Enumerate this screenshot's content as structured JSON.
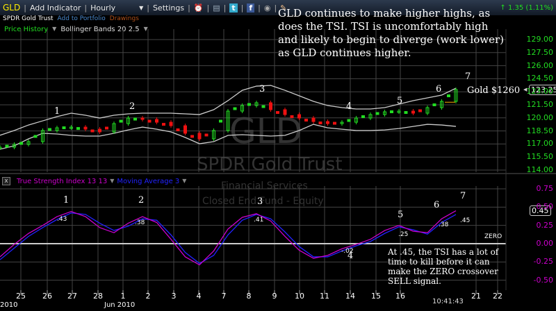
{
  "toolbar": {
    "symbol": "GLD",
    "add_indicator": "Add Indicator",
    "interval": "Hourly",
    "settings": "Settings",
    "change": "1.35 (1.11%)",
    "icons": [
      "alarm-clock-icon",
      "copy-icon",
      "twitter-icon",
      "facebook-icon",
      "camera-icon",
      "note-icon"
    ]
  },
  "subheader": {
    "name": "SPDR Gold Trust",
    "add_portfolio": "Add to Portfolio",
    "drawings": "Drawings"
  },
  "price_panel": {
    "indicator1": "Price History",
    "indicator2": "Bollinger Bands 20 2.5",
    "current_price": "123.25",
    "y_ticks": [
      "129.00",
      "127.50",
      "126.00",
      "124.50",
      "123.00",
      "121.50",
      "120.00",
      "118.50",
      "117.00",
      "115.50",
      "114.00"
    ],
    "annotation": "GLD continues to make higher highs, as does the TSI.  TSI is uncomfortably high and likely to begin to diverge (work lower) as GLD continues higher.",
    "gold_label": "Gold $1260",
    "wave_labels": [
      "1",
      "2",
      "3",
      "4",
      "5",
      "6",
      "7"
    ]
  },
  "watermark": {
    "symbol": "GLD",
    "name": "SPDR Gold Trust",
    "sector": "Financial Services",
    "type": "Closed End Fund - Equity"
  },
  "tsi_panel": {
    "close_icon": "close-icon",
    "indicator1": "True Strength Index 13 13",
    "indicator2": "Moving Average 3",
    "current_value": "0.45",
    "y_ticks": [
      "0.75",
      "0.50",
      "0.25",
      "0.00",
      "-0.25",
      "-0.50"
    ],
    "wave_labels": [
      "1",
      "2",
      "3",
      "4",
      "5",
      "6",
      "7"
    ],
    "value_labels": [
      ".43",
      ".38",
      ".41",
      "-.02",
      ".25",
      ".38",
      ".45"
    ],
    "zero_label": "ZERO",
    "annotation": "At .45, the TSI has a lot of time to kill before it can make the ZERO crossover SELL signal."
  },
  "x_axis": {
    "labels": [
      "25",
      "26",
      "27",
      "28",
      "1",
      "2",
      "3",
      "4",
      "7",
      "8",
      "9",
      "10",
      "11",
      "14",
      "15",
      "16",
      "21",
      "22"
    ],
    "month_labels": [
      "2010",
      "Jun 2010"
    ],
    "time": "10:41:43"
  },
  "colors": {
    "up": "#22dd22",
    "down": "#ee1111",
    "tsi": "#cc00cc",
    "ma": "#2222ff",
    "band": "#cccccc",
    "axis_price": "#22dd22",
    "axis_tsi": "#cc00cc"
  },
  "chart_data": [
    {
      "type": "line",
      "title": "Price History",
      "x_labels": [
        "25",
        "26",
        "27",
        "28",
        "1",
        "2",
        "3",
        "4",
        "7",
        "8",
        "9",
        "10",
        "11",
        "14",
        "15",
        "16",
        "21",
        "22"
      ],
      "ylim": [
        114,
        129
      ],
      "grid": true,
      "series": [
        {
          "name": "Price History",
          "values": [
            116.63,
            116.95,
            117.27,
            118.55,
            118.86,
            118.94,
            118.7,
            118.39,
            119.34,
            119.98,
            119.82,
            119.5,
            119.1,
            118.23,
            117.59,
            118.55,
            120.78,
            121.42,
            121.74,
            120.94,
            120.38,
            119.98,
            119.58,
            119.34,
            119.5,
            119.98,
            120.38,
            120.7,
            120.78,
            120.54,
            121.18,
            121.9,
            123.25
          ]
        },
        {
          "name": "Bollinger Bands 20 2.5",
          "band": "upper",
          "values": [
            118.0,
            118.55,
            119.18,
            119.66,
            120.14,
            120.54,
            120.3,
            119.98,
            120.3,
            120.46,
            120.54,
            120.54,
            120.54,
            120.46,
            120.38,
            120.94,
            121.98,
            123.17,
            123.65,
            123.73,
            123.17,
            122.54,
            121.9,
            121.42,
            121.18,
            121.02,
            121.02,
            121.18,
            121.58,
            121.98,
            122.3,
            122.62,
            123.41
          ]
        },
        {
          "name": "Bollinger Bands 20 2.5",
          "band": "lower",
          "values": [
            116.39,
            116.79,
            117.59,
            118.23,
            118.15,
            117.99,
            117.91,
            117.91,
            118.23,
            118.62,
            118.94,
            118.7,
            118.39,
            117.75,
            117.03,
            117.27,
            117.99,
            118.07,
            117.99,
            117.91,
            117.99,
            118.55,
            119.26,
            118.86,
            118.7,
            118.55,
            118.55,
            118.62,
            118.78,
            119.02,
            119.26,
            119.18,
            119.02
          ]
        }
      ]
    },
    {
      "type": "line",
      "title": "True Strength Index 13 13",
      "ylim": [
        -0.5,
        0.75
      ],
      "grid": true,
      "series": [
        {
          "name": "True Strength Index 13 13",
          "values": [
            -0.18,
            -0.01,
            0.14,
            0.25,
            0.37,
            0.44,
            0.37,
            0.22,
            0.15,
            0.28,
            0.37,
            0.29,
            0.06,
            -0.18,
            -0.29,
            -0.1,
            0.2,
            0.36,
            0.41,
            0.31,
            0.1,
            -0.09,
            -0.2,
            -0.16,
            -0.07,
            -0.01,
            0.06,
            0.18,
            0.25,
            0.17,
            0.15,
            0.34,
            0.45
          ]
        },
        {
          "name": "Moving Average 3",
          "values": [
            -0.22,
            -0.06,
            0.1,
            0.22,
            0.33,
            0.42,
            0.4,
            0.28,
            0.18,
            0.24,
            0.34,
            0.32,
            0.12,
            -0.12,
            -0.27,
            -0.16,
            0.12,
            0.32,
            0.4,
            0.34,
            0.16,
            -0.04,
            -0.18,
            -0.18,
            -0.1,
            -0.03,
            0.03,
            0.14,
            0.23,
            0.19,
            0.13,
            0.29,
            0.4
          ]
        }
      ]
    }
  ]
}
